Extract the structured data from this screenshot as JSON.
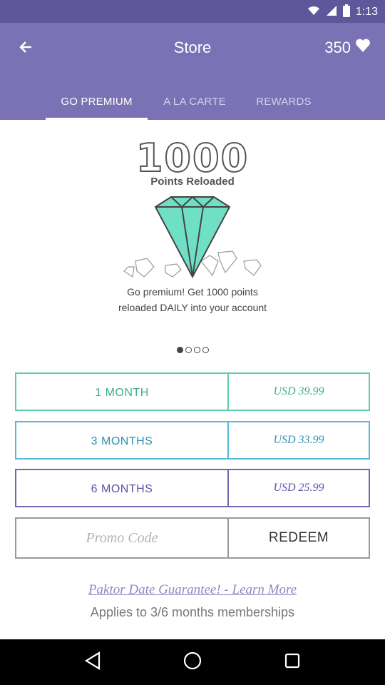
{
  "status_bar": {
    "time": "1:13"
  },
  "header": {
    "title": "Store",
    "points": "350"
  },
  "tabs": [
    {
      "label": "GO PREMIUM",
      "active": true
    },
    {
      "label": "A LA CARTE",
      "active": false
    },
    {
      "label": "REWARDS",
      "active": false
    }
  ],
  "hero": {
    "number": "1000",
    "subtitle": "Points Reloaded",
    "description_line1": "Go premium! Get 1000 points",
    "description_line2": "reloaded DAILY into your account",
    "page_dots": {
      "count": 4,
      "active_index": 0
    }
  },
  "plans": [
    {
      "duration": "1 MONTH",
      "price": "USD 39.99"
    },
    {
      "duration": "3 MONTHS",
      "price": "USD 33.99"
    },
    {
      "duration": "6 MONTHS",
      "price": "USD 25.99"
    }
  ],
  "promo": {
    "placeholder": "Promo Code",
    "redeem_label": "REDEEM"
  },
  "footer": {
    "learn_more": "Paktor Date Guarantee! - Learn More",
    "applies": "Applies to 3/6 months memberships"
  },
  "colors": {
    "header_bg": "#7a72b5",
    "status_bg": "#5e5799",
    "plan_green": "#5fcca9",
    "plan_blue": "#58b9d6",
    "plan_purple": "#7068b6",
    "gem_teal": "#6fe0c6"
  },
  "icons": {
    "back": "arrow-left-icon",
    "points": "heart-icon",
    "nav": [
      "back-triangle-icon",
      "home-circle-icon",
      "recents-square-icon"
    ]
  }
}
